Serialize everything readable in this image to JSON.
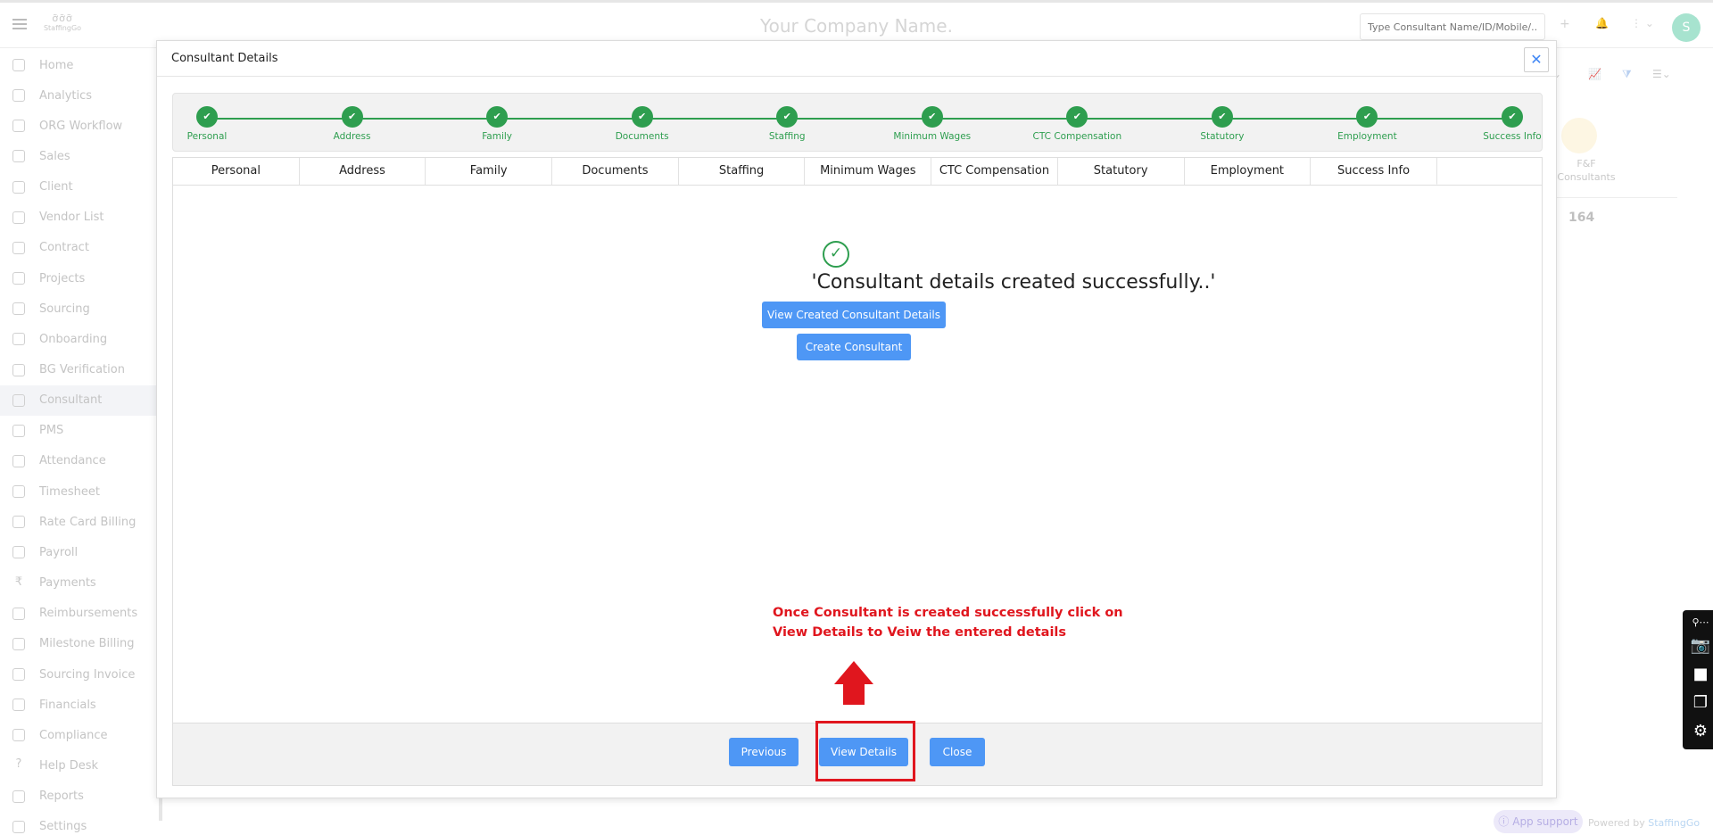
{
  "header": {
    "company_name": "Your Company Name.",
    "logo_mark": "ỡỡỡ",
    "logo_text": "StaffingGo",
    "search_placeholder": "Type Consultant Name/ID/Mobile/...",
    "plus_icon": "+",
    "bell_icon": "🔔",
    "more_icon": "⋮ ⌄",
    "avatar_initial": "S"
  },
  "sidebar": {
    "items": [
      {
        "label": "Home",
        "icon": "home-icon"
      },
      {
        "label": "Analytics",
        "icon": "analytics-icon"
      },
      {
        "label": "ORG Workflow",
        "icon": "workflow-icon"
      },
      {
        "label": "Sales",
        "icon": "sales-icon"
      },
      {
        "label": "Client",
        "icon": "client-icon"
      },
      {
        "label": "Vendor List",
        "icon": "vendor-icon"
      },
      {
        "label": "Contract",
        "icon": "contract-icon"
      },
      {
        "label": "Projects",
        "icon": "projects-icon"
      },
      {
        "label": "Sourcing",
        "icon": "sourcing-icon"
      },
      {
        "label": "Onboarding",
        "icon": "onboarding-icon"
      },
      {
        "label": "BG Verification",
        "icon": "verification-icon"
      },
      {
        "label": "Consultant",
        "icon": "consultant-icon"
      },
      {
        "label": "PMS",
        "icon": "pms-icon"
      },
      {
        "label": "Attendance",
        "icon": "attendance-icon"
      },
      {
        "label": "Timesheet",
        "icon": "timesheet-icon"
      },
      {
        "label": "Rate Card Billing",
        "icon": "rate-card-icon"
      },
      {
        "label": "Payroll",
        "icon": "payroll-icon"
      },
      {
        "label": "Payments",
        "icon": "rupee-icon"
      },
      {
        "label": "Reimbursements",
        "icon": "reimbursements-icon"
      },
      {
        "label": "Milestone Billing",
        "icon": "milestone-icon"
      },
      {
        "label": "Sourcing Invoice",
        "icon": "invoice-icon"
      },
      {
        "label": "Financials",
        "icon": "financials-icon"
      },
      {
        "label": "Compliance",
        "icon": "compliance-icon"
      },
      {
        "label": "Help Desk",
        "icon": "help-icon"
      },
      {
        "label": "Reports",
        "icon": "reports-icon"
      },
      {
        "label": "Settings",
        "icon": "settings-icon"
      }
    ],
    "active_item": "Consultant"
  },
  "background": {
    "ff_label": "F&F Consultants",
    "ff_count": "164"
  },
  "modal": {
    "title": "Consultant Details",
    "close_symbol": "✕",
    "steps": [
      "Personal",
      "Address",
      "Family",
      "Documents",
      "Staffing",
      "Minimum Wages",
      "CTC Compensation",
      "Statutory",
      "Employment",
      "Success Info"
    ],
    "step_check": "✔",
    "tabs": [
      "Personal",
      "Address",
      "Family",
      "Documents",
      "Staffing",
      "Minimum Wages",
      "CTC Compensation",
      "Statutory",
      "Employment",
      "Success Info"
    ],
    "active_tab": "Success Info",
    "success_message": "'Consultant details created successfully..'",
    "success_check": "✓",
    "view_created_button": "View Created Consultant Details",
    "create_consultant_button": "Create Consultant",
    "previous_button": "Previous",
    "view_details_button": "View Details",
    "close_button": "Close"
  },
  "annotation": {
    "line1": "Once Consultant is created successfully click on",
    "line2": "View Details to Veiw the entered details",
    "color": "#e0161e"
  },
  "footer": {
    "app_support": "App support",
    "powered_by": "Powered by",
    "brand": "StaffingGo"
  },
  "colors": {
    "primary_button": "#4e97f5",
    "success_green": "#2e9e4f"
  }
}
